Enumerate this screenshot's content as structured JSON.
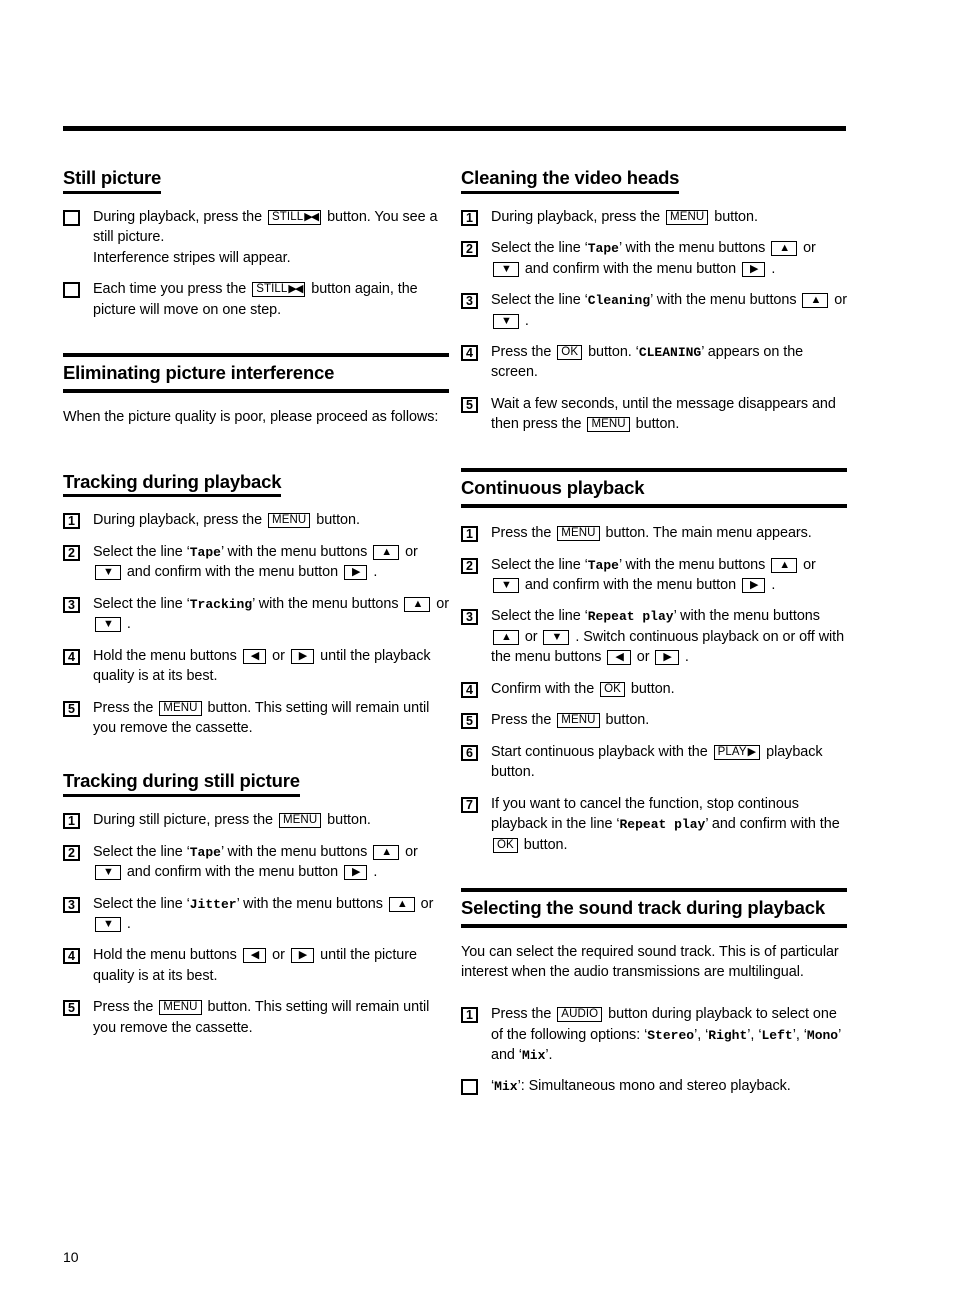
{
  "page": {
    "number": "10"
  },
  "left_column": {
    "sections": [
      {
        "id": "still-picture",
        "heading": "Still picture",
        "heading_style": "sub",
        "items": [
          {
            "marker": "box",
            "parts": [
              {
                "t": "text",
                "v": "During playback, press the "
              },
              {
                "t": "key",
                "v": "STILL",
                "glyph": "▶◀"
              },
              {
                "t": "text",
                "v": " button. You see a still picture."
              },
              {
                "t": "br"
              },
              {
                "t": "text",
                "v": "Interference stripes will appear."
              }
            ]
          },
          {
            "marker": "box",
            "parts": [
              {
                "t": "text",
                "v": "Each time you press the "
              },
              {
                "t": "key",
                "v": "STILL",
                "glyph": "▶◀"
              },
              {
                "t": "text",
                "v": " button again, the picture will move on one step."
              }
            ]
          }
        ]
      },
      {
        "id": "eliminating-picture-interference",
        "heading": "Eliminating picture interference",
        "heading_style": "major",
        "intro": "When the picture quality is poor, please proceed as follows:",
        "items": []
      },
      {
        "id": "tracking-during-playback",
        "heading": "Tracking during playback",
        "heading_style": "sub",
        "items": [
          {
            "marker": "1",
            "parts": [
              {
                "t": "text",
                "v": "During playback, press the "
              },
              {
                "t": "key",
                "v": "MENU"
              },
              {
                "t": "text",
                "v": " button."
              }
            ]
          },
          {
            "marker": "2",
            "parts": [
              {
                "t": "text",
                "v": "Select the line ‘"
              },
              {
                "t": "mono",
                "v": "Tape"
              },
              {
                "t": "text",
                "v": "’ with the menu buttons "
              },
              {
                "t": "key",
                "v": "",
                "glyph": "▲"
              },
              {
                "t": "text",
                "v": " or "
              },
              {
                "t": "key",
                "v": "",
                "glyph": "▼"
              },
              {
                "t": "text",
                "v": " and confirm with the menu button "
              },
              {
                "t": "key",
                "v": "",
                "glyph": "▶"
              },
              {
                "t": "text",
                "v": " ."
              }
            ]
          },
          {
            "marker": "3",
            "parts": [
              {
                "t": "text",
                "v": "Select the line ‘"
              },
              {
                "t": "mono",
                "v": "Tracking"
              },
              {
                "t": "text",
                "v": "’ with the menu buttons "
              },
              {
                "t": "key",
                "v": "",
                "glyph": "▲"
              },
              {
                "t": "text",
                "v": " or "
              },
              {
                "t": "key",
                "v": "",
                "glyph": "▼"
              },
              {
                "t": "text",
                "v": " ."
              }
            ]
          },
          {
            "marker": "4",
            "parts": [
              {
                "t": "text",
                "v": "Hold the menu buttons "
              },
              {
                "t": "key",
                "v": "",
                "glyph": "◀"
              },
              {
                "t": "text",
                "v": " or "
              },
              {
                "t": "key",
                "v": "",
                "glyph": "▶"
              },
              {
                "t": "text",
                "v": " until the playback quality is at its best."
              }
            ]
          },
          {
            "marker": "5",
            "parts": [
              {
                "t": "text",
                "v": "Press the "
              },
              {
                "t": "key",
                "v": "MENU"
              },
              {
                "t": "text",
                "v": " button. This setting will remain until you remove the cassette."
              }
            ]
          }
        ]
      },
      {
        "id": "tracking-during-still-picture",
        "heading": "Tracking during still picture",
        "heading_style": "sub",
        "items": [
          {
            "marker": "1",
            "parts": [
              {
                "t": "text",
                "v": "During still picture, press the "
              },
              {
                "t": "key",
                "v": "MENU"
              },
              {
                "t": "text",
                "v": " button."
              }
            ]
          },
          {
            "marker": "2",
            "parts": [
              {
                "t": "text",
                "v": "Select the line ‘"
              },
              {
                "t": "mono",
                "v": "Tape"
              },
              {
                "t": "text",
                "v": "’ with the menu buttons "
              },
              {
                "t": "key",
                "v": "",
                "glyph": "▲"
              },
              {
                "t": "text",
                "v": " or "
              },
              {
                "t": "key",
                "v": "",
                "glyph": "▼"
              },
              {
                "t": "text",
                "v": " and confirm with the menu button "
              },
              {
                "t": "key",
                "v": "",
                "glyph": "▶"
              },
              {
                "t": "text",
                "v": " ."
              }
            ]
          },
          {
            "marker": "3",
            "parts": [
              {
                "t": "text",
                "v": "Select the line ‘"
              },
              {
                "t": "mono",
                "v": "Jitter"
              },
              {
                "t": "text",
                "v": "’ with the menu buttons "
              },
              {
                "t": "key",
                "v": "",
                "glyph": "▲"
              },
              {
                "t": "text",
                "v": " or "
              },
              {
                "t": "key",
                "v": "",
                "glyph": "▼"
              },
              {
                "t": "text",
                "v": " ."
              }
            ]
          },
          {
            "marker": "4",
            "parts": [
              {
                "t": "text",
                "v": "Hold the menu buttons "
              },
              {
                "t": "key",
                "v": "",
                "glyph": "◀"
              },
              {
                "t": "text",
                "v": " or "
              },
              {
                "t": "key",
                "v": "",
                "glyph": "▶"
              },
              {
                "t": "text",
                "v": " until the picture quality is at its best."
              }
            ]
          },
          {
            "marker": "5",
            "parts": [
              {
                "t": "text",
                "v": "Press the "
              },
              {
                "t": "key",
                "v": "MENU"
              },
              {
                "t": "text",
                "v": " button. This setting will remain until you remove the cassette."
              }
            ]
          }
        ]
      }
    ]
  },
  "right_column": {
    "sections": [
      {
        "id": "cleaning-the-video-heads",
        "heading": "Cleaning the video heads",
        "heading_style": "sub",
        "items": [
          {
            "marker": "1",
            "parts": [
              {
                "t": "text",
                "v": "During playback, press the "
              },
              {
                "t": "key",
                "v": "MENU"
              },
              {
                "t": "text",
                "v": " button."
              }
            ]
          },
          {
            "marker": "2",
            "parts": [
              {
                "t": "text",
                "v": "Select the line ‘"
              },
              {
                "t": "mono",
                "v": "Tape"
              },
              {
                "t": "text",
                "v": "’ with the menu buttons "
              },
              {
                "t": "key",
                "v": "",
                "glyph": "▲"
              },
              {
                "t": "text",
                "v": " or "
              },
              {
                "t": "key",
                "v": "",
                "glyph": "▼"
              },
              {
                "t": "text",
                "v": " and confirm with the menu button "
              },
              {
                "t": "key",
                "v": "",
                "glyph": "▶"
              },
              {
                "t": "text",
                "v": " ."
              }
            ]
          },
          {
            "marker": "3",
            "parts": [
              {
                "t": "text",
                "v": "Select the line ‘"
              },
              {
                "t": "mono",
                "v": "Cleaning"
              },
              {
                "t": "text",
                "v": "’ with the menu buttons "
              },
              {
                "t": "key",
                "v": "",
                "glyph": "▲"
              },
              {
                "t": "text",
                "v": " or "
              },
              {
                "t": "key",
                "v": "",
                "glyph": "▼"
              },
              {
                "t": "text",
                "v": " ."
              }
            ]
          },
          {
            "marker": "4",
            "parts": [
              {
                "t": "text",
                "v": "Press the "
              },
              {
                "t": "key",
                "v": "OK"
              },
              {
                "t": "text",
                "v": " button. ‘"
              },
              {
                "t": "mono",
                "v": "CLEANING"
              },
              {
                "t": "text",
                "v": "’ appears on the screen."
              }
            ]
          },
          {
            "marker": "5",
            "parts": [
              {
                "t": "text",
                "v": "Wait a few seconds, until the message disappears and then press the "
              },
              {
                "t": "key",
                "v": "MENU"
              },
              {
                "t": "text",
                "v": " button."
              }
            ]
          }
        ]
      },
      {
        "id": "continuous-playback",
        "heading": "Continuous playback",
        "heading_style": "major",
        "items": [
          {
            "marker": "1",
            "parts": [
              {
                "t": "text",
                "v": "Press the "
              },
              {
                "t": "key",
                "v": "MENU"
              },
              {
                "t": "text",
                "v": " button. The main menu appears."
              }
            ]
          },
          {
            "marker": "2",
            "parts": [
              {
                "t": "text",
                "v": "Select the line ‘"
              },
              {
                "t": "mono",
                "v": "Tape"
              },
              {
                "t": "text",
                "v": "’ with the menu buttons "
              },
              {
                "t": "key",
                "v": "",
                "glyph": "▲"
              },
              {
                "t": "text",
                "v": " or "
              },
              {
                "t": "key",
                "v": "",
                "glyph": "▼"
              },
              {
                "t": "text",
                "v": " and confirm with the menu button "
              },
              {
                "t": "key",
                "v": "",
                "glyph": "▶"
              },
              {
                "t": "text",
                "v": " ."
              }
            ]
          },
          {
            "marker": "3",
            "parts": [
              {
                "t": "text",
                "v": "Select the line ‘"
              },
              {
                "t": "mono",
                "v": "Repeat play"
              },
              {
                "t": "text",
                "v": "’ with the menu buttons "
              },
              {
                "t": "key",
                "v": "",
                "glyph": "▲"
              },
              {
                "t": "text",
                "v": " or "
              },
              {
                "t": "key",
                "v": "",
                "glyph": "▼"
              },
              {
                "t": "text",
                "v": " . Switch continuous playback on or off with the menu buttons "
              },
              {
                "t": "key",
                "v": "",
                "glyph": "◀"
              },
              {
                "t": "text",
                "v": " or "
              },
              {
                "t": "key",
                "v": "",
                "glyph": "▶"
              },
              {
                "t": "text",
                "v": " ."
              }
            ]
          },
          {
            "marker": "4",
            "parts": [
              {
                "t": "text",
                "v": "Confirm with the "
              },
              {
                "t": "key",
                "v": "OK"
              },
              {
                "t": "text",
                "v": " button."
              }
            ]
          },
          {
            "marker": "5",
            "parts": [
              {
                "t": "text",
                "v": "Press the "
              },
              {
                "t": "key",
                "v": "MENU"
              },
              {
                "t": "text",
                "v": " button."
              }
            ]
          },
          {
            "marker": "6",
            "parts": [
              {
                "t": "text",
                "v": "Start continuous playback with the "
              },
              {
                "t": "key",
                "v": "PLAY",
                "glyph": "▶"
              },
              {
                "t": "text",
                "v": " playback button."
              }
            ]
          },
          {
            "marker": "7",
            "parts": [
              {
                "t": "text",
                "v": "If you want to cancel the function, stop continous playback in the line ‘"
              },
              {
                "t": "mono",
                "v": "Repeat play"
              },
              {
                "t": "text",
                "v": "’ and confirm with the "
              },
              {
                "t": "key",
                "v": "OK"
              },
              {
                "t": "text",
                "v": " button."
              }
            ]
          }
        ]
      },
      {
        "id": "selecting-the-sound-track-during-playback",
        "heading": "Selecting the sound track during playback",
        "heading_style": "major",
        "intro": "You can select the required sound track. This is of particular interest when the audio transmissions are multilingual.",
        "items": [
          {
            "marker": "1",
            "parts": [
              {
                "t": "text",
                "v": "Press the "
              },
              {
                "t": "key",
                "v": "AUDIO"
              },
              {
                "t": "text",
                "v": " button during playback to select one of the following options: ‘"
              },
              {
                "t": "mono",
                "v": "Stereo"
              },
              {
                "t": "text",
                "v": "’, ‘"
              },
              {
                "t": "mono",
                "v": "Right"
              },
              {
                "t": "text",
                "v": "’, ‘"
              },
              {
                "t": "mono",
                "v": "Left"
              },
              {
                "t": "text",
                "v": "’, ‘"
              },
              {
                "t": "mono",
                "v": "Mono"
              },
              {
                "t": "text",
                "v": "’ and ‘"
              },
              {
                "t": "mono",
                "v": "Mix"
              },
              {
                "t": "text",
                "v": "’."
              }
            ]
          },
          {
            "marker": "box",
            "parts": [
              {
                "t": "text",
                "v": "‘"
              },
              {
                "t": "mono",
                "v": "Mix"
              },
              {
                "t": "text",
                "v": "’: Simultaneous mono and stereo playback."
              }
            ]
          }
        ]
      }
    ]
  }
}
